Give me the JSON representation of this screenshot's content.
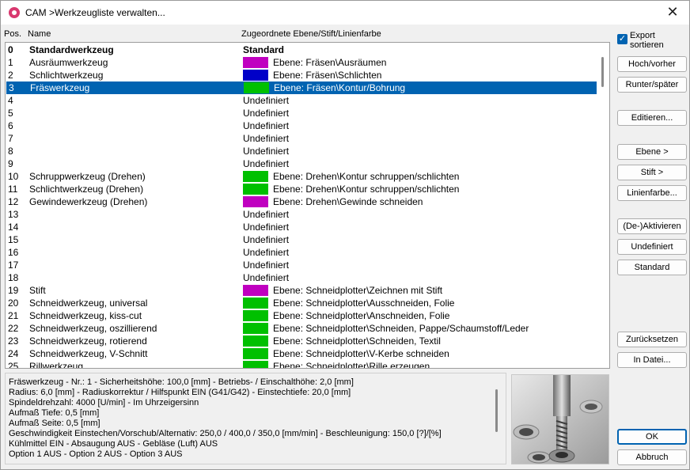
{
  "window": {
    "title": "CAM >Werkzeugliste verwalten...",
    "close_glyph": "✕"
  },
  "columns": {
    "pos": "Pos.",
    "name": "Name",
    "layer": "Zugeordnete Ebene/Stift/Linienfarbe"
  },
  "rows": [
    {
      "pos": "0",
      "name": "Standardwerkzeug",
      "layer": "Standard",
      "color": "",
      "bold": true
    },
    {
      "pos": "1",
      "name": "Ausräumwerkzeug",
      "layer": "Ebene: Fräsen\\Ausräumen",
      "color": "#c000c0"
    },
    {
      "pos": "2",
      "name": "Schlichtwerkzeug",
      "layer": "Ebene: Fräsen\\Schlichten",
      "color": "#0000c8"
    },
    {
      "pos": "3",
      "name": "Fräswerkzeug",
      "layer": "Ebene: Fräsen\\Kontur/Bohrung",
      "color": "#00c000",
      "selected": true
    },
    {
      "pos": "4",
      "name": "",
      "layer": "Undefiniert",
      "color": ""
    },
    {
      "pos": "5",
      "name": "",
      "layer": "Undefiniert",
      "color": ""
    },
    {
      "pos": "6",
      "name": "",
      "layer": "Undefiniert",
      "color": ""
    },
    {
      "pos": "7",
      "name": "",
      "layer": "Undefiniert",
      "color": ""
    },
    {
      "pos": "8",
      "name": "",
      "layer": "Undefiniert",
      "color": ""
    },
    {
      "pos": "9",
      "name": "",
      "layer": "Undefiniert",
      "color": ""
    },
    {
      "pos": "10",
      "name": "Schruppwerkzeug (Drehen)",
      "layer": "Ebene: Drehen\\Kontur schruppen/schlichten",
      "color": "#00c000"
    },
    {
      "pos": "11",
      "name": "Schlichtwerkzeug (Drehen)",
      "layer": "Ebene: Drehen\\Kontur schruppen/schlichten",
      "color": "#00c000"
    },
    {
      "pos": "12",
      "name": "Gewindewerkzeug (Drehen)",
      "layer": "Ebene: Drehen\\Gewinde schneiden",
      "color": "#c000c0"
    },
    {
      "pos": "13",
      "name": "",
      "layer": "Undefiniert",
      "color": ""
    },
    {
      "pos": "14",
      "name": "",
      "layer": "Undefiniert",
      "color": ""
    },
    {
      "pos": "15",
      "name": "",
      "layer": "Undefiniert",
      "color": ""
    },
    {
      "pos": "16",
      "name": "",
      "layer": "Undefiniert",
      "color": ""
    },
    {
      "pos": "17",
      "name": "",
      "layer": "Undefiniert",
      "color": ""
    },
    {
      "pos": "18",
      "name": "",
      "layer": "Undefiniert",
      "color": ""
    },
    {
      "pos": "19",
      "name": "Stift",
      "layer": "Ebene: Schneidplotter\\Zeichnen mit Stift",
      "color": "#c000c0"
    },
    {
      "pos": "20",
      "name": "Schneidwerkzeug, universal",
      "layer": "Ebene: Schneidplotter\\Ausschneiden, Folie",
      "color": "#00c000"
    },
    {
      "pos": "21",
      "name": "Schneidwerkzeug, kiss-cut",
      "layer": "Ebene: Schneidplotter\\Anschneiden, Folie",
      "color": "#00c000"
    },
    {
      "pos": "22",
      "name": "Schneidwerkzeug, oszillierend",
      "layer": "Ebene: Schneidplotter\\Schneiden, Pappe/Schaumstoff/Leder",
      "color": "#00c000"
    },
    {
      "pos": "23",
      "name": "Schneidwerkzeug, rotierend",
      "layer": "Ebene: Schneidplotter\\Schneiden, Textil",
      "color": "#00c000"
    },
    {
      "pos": "24",
      "name": "Schneidwerkzeug, V-Schnitt",
      "layer": "Ebene: Schneidplotter\\V-Kerbe schneiden",
      "color": "#00c000"
    },
    {
      "pos": "25",
      "name": "Rillwerkzeug",
      "layer": "Ebene: Schneidplotter\\Rille erzeugen",
      "color": "#00c000"
    }
  ],
  "info": {
    "lines": [
      "Fräswerkzeug  -  Nr.: 1  -  Sicherheitshöhe: 100,0 [mm]  -  Betriebs- / Einschalthöhe: 2,0 [mm]",
      "Radius: 6,0 [mm]  -  Radiuskorrektur / Hilfspunkt  EIN (G41/G42)  -  Einstechtiefe: 20,0 [mm]",
      "Spindeldrehzahl: 4000 [U/min]  -  Im Uhrzeigersinn",
      "Aufmaß Tiefe: 0,5 [mm]",
      "Aufmaß Seite: 0,5 [mm]",
      "Geschwindigkeit Einstechen/Vorschub/Alternativ: 250,0 / 400,0 / 350,0 [mm/min]  -  Beschleunigung: 150,0 [?]/[%]",
      "Kühlmittel EIN - Absaugung AUS - Gebläse (Luft) AUS",
      "Option 1 AUS - Option 2 AUS - Option 3 AUS"
    ]
  },
  "side": {
    "export_sort_label_1": "Export",
    "export_sort_label_2": "sortieren",
    "export_sort_checked": "✓",
    "btn_up": "Hoch/vorher",
    "btn_down": "Runter/später",
    "btn_edit": "Editieren...",
    "btn_layer": "Ebene >",
    "btn_pen": "Stift >",
    "btn_linecolor": "Linienfarbe...",
    "btn_toggle": "(De-)Aktivieren",
    "btn_undefined": "Undefiniert",
    "btn_standard": "Standard",
    "btn_reset": "Zurücksetzen",
    "btn_tofile": "In Datei...",
    "btn_ok": "OK",
    "btn_cancel": "Abbruch"
  }
}
